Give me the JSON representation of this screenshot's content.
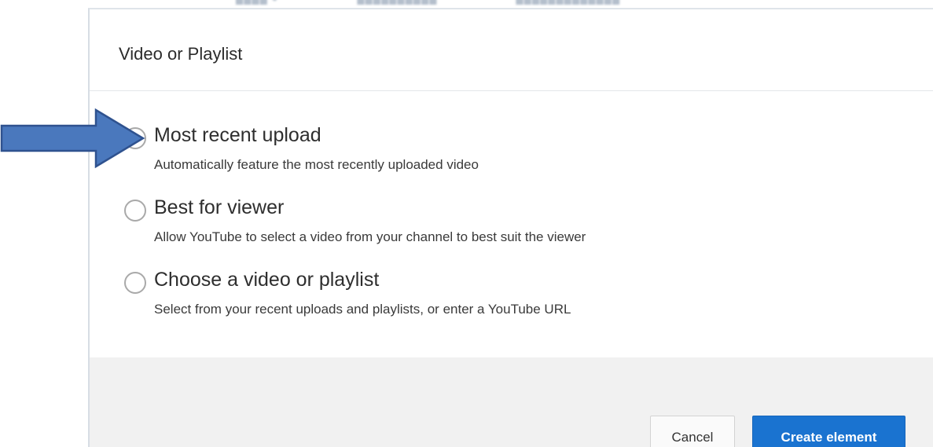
{
  "dialog": {
    "title": "Video or Playlist",
    "options": [
      {
        "label": "Most recent upload",
        "description": "Automatically feature the most recently uploaded video",
        "selected": false
      },
      {
        "label": "Best for viewer",
        "description": "Allow YouTube to select a video from your channel to best suit the viewer",
        "selected": false
      },
      {
        "label": "Choose a video or playlist",
        "description": "Select from your recent uploads and playlists, or enter a YouTube URL",
        "selected": false
      }
    ],
    "buttons": {
      "cancel_label": "Cancel",
      "create_label": "Create element"
    }
  },
  "annotation": {
    "arrow_color": "#4a78bd",
    "arrow_border_color": "#2f528f",
    "icon": "arrow-right-icon"
  },
  "colors": {
    "primary_button": "#1a73d0",
    "footer_background": "#f1f1f1"
  }
}
